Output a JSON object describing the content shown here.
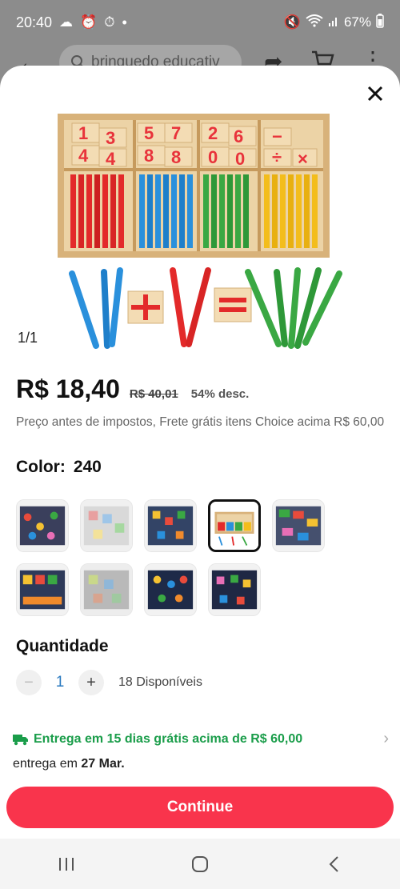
{
  "status_bar": {
    "time": "20:40",
    "dot": "•",
    "battery": "67%"
  },
  "background_header": {
    "search_text": "brinquedo educativ"
  },
  "product": {
    "image_counter": "1/1",
    "price": "R$ 18,40",
    "old_price": "R$ 40,01",
    "discount": "54% desc.",
    "tax_note": "Preço antes de impostos, Frete grátis itens Choice acima R$ 60,00"
  },
  "color": {
    "label": "Color:",
    "value": "240",
    "swatch_count": 9,
    "selected_index": 3
  },
  "quantity": {
    "title": "Quantidade",
    "minus": "−",
    "value": "1",
    "plus": "+",
    "available": "18 Disponíveis"
  },
  "delivery": {
    "text": "Entrega em 15 dias grátis acima de R$ 60,00",
    "date_prefix": "entrega em",
    "date": "27 Mar."
  },
  "actions": {
    "continue_label": "Continue"
  },
  "colors": {
    "accent": "#f9344c",
    "delivery_green": "#1a9d4a",
    "qty_blue": "#2a7ac0"
  },
  "icons": [
    "close-icon",
    "truck-icon",
    "chevron-right-icon",
    "back-icon",
    "search-icon",
    "share-icon",
    "cart-icon",
    "more-icon",
    "recents-icon",
    "home-icon",
    "nav-back-icon"
  ]
}
